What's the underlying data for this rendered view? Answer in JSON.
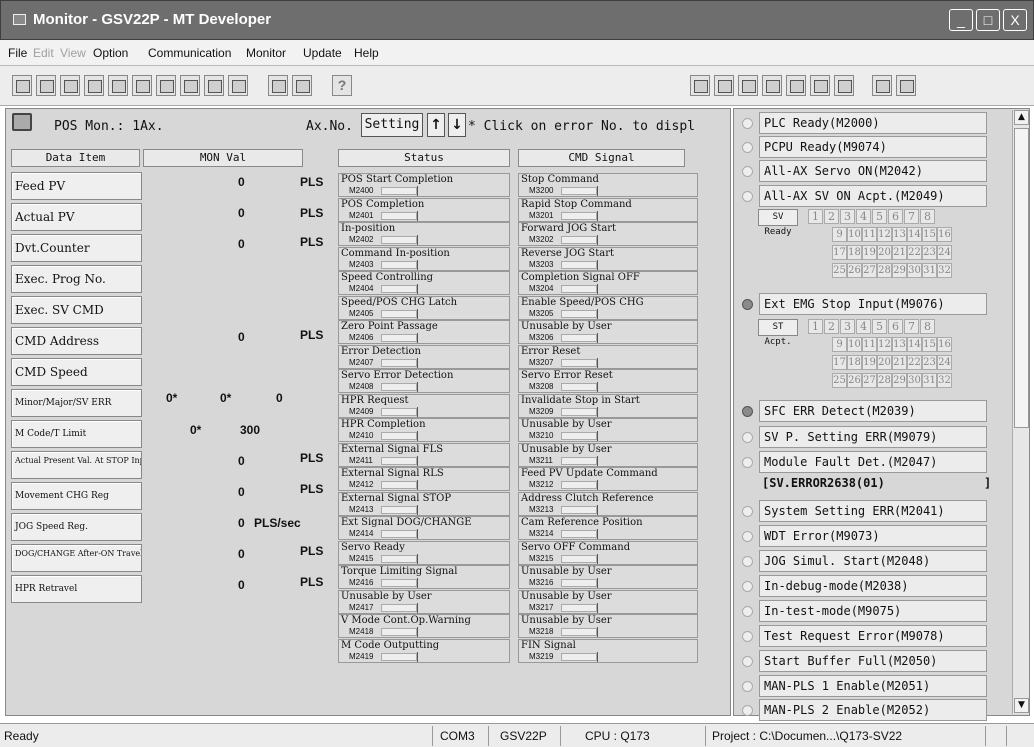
{
  "window": {
    "title": "Monitor - GSV22P - MT Developer",
    "min": "_",
    "max": "□",
    "close": "X"
  },
  "menu": [
    "File",
    "Edit",
    "View",
    "Option",
    "Communication",
    "Monitor",
    "Update",
    "Help"
  ],
  "toolbar": {
    "help": "?"
  },
  "pos": {
    "label": "POS Mon.: 1Ax.",
    "axno": "Ax.No.",
    "setting": "Setting",
    "up": "↑",
    "down": "↓",
    "note": "* Click on error No. to displ"
  },
  "headers": {
    "item": "Data Item",
    "mon": "MON Val",
    "status": "Status",
    "cmd": "CMD Signal"
  },
  "items": [
    {
      "label": "Feed PV",
      "val": "0",
      "unit": "PLS"
    },
    {
      "label": "Actual PV",
      "val": "0",
      "unit": "PLS"
    },
    {
      "label": "Dvt.Counter",
      "val": "0",
      "unit": "PLS"
    },
    {
      "label": "Exec. Prog No.",
      "val": "",
      "unit": ""
    },
    {
      "label": "Exec. SV CMD",
      "val": "",
      "unit": ""
    },
    {
      "label": "CMD Address",
      "val": "0",
      "unit": "PLS"
    },
    {
      "label": "CMD Speed",
      "val": "",
      "unit": ""
    },
    {
      "label": "Minor/Major/SV ERR",
      "v1": "0*",
      "v2": "0*",
      "v3": "0"
    },
    {
      "label": "M Code/T Limit",
      "v1": "0*",
      "v2": "300"
    },
    {
      "label": "Actual Present Val. At STOP Input",
      "val": "0",
      "unit": "PLS"
    },
    {
      "label": "Movement CHG Reg",
      "val": "0",
      "unit": "PLS"
    },
    {
      "label": "JOG Speed Reg.",
      "val": "0",
      "unit": "PLS/sec"
    },
    {
      "label": "DOG/CHANGE After-ON Travel",
      "val": "0",
      "unit": "PLS"
    },
    {
      "label": "HPR Retravel",
      "val": "0",
      "unit": "PLS"
    }
  ],
  "status": [
    {
      "name": "POS Start Completion",
      "m": "M2400"
    },
    {
      "name": "POS Completion",
      "m": "M2401"
    },
    {
      "name": "In-position",
      "m": "M2402"
    },
    {
      "name": "Command In-position",
      "m": "M2403"
    },
    {
      "name": "Speed Controlling",
      "m": "M2404"
    },
    {
      "name": "Speed/POS CHG Latch",
      "m": "M2405"
    },
    {
      "name": "Zero Point Passage",
      "m": "M2406"
    },
    {
      "name": "Error Detection",
      "m": "M2407"
    },
    {
      "name": "Servo Error Detection",
      "m": "M2408"
    },
    {
      "name": "HPR Request",
      "m": "M2409"
    },
    {
      "name": "HPR Completion",
      "m": "M2410"
    },
    {
      "name": "External Signal FLS",
      "m": "M2411"
    },
    {
      "name": "External Signal RLS",
      "m": "M2412"
    },
    {
      "name": "External Signal STOP",
      "m": "M2413"
    },
    {
      "name": "Ext Signal DOG/CHANGE",
      "m": "M2414"
    },
    {
      "name": "Servo Ready",
      "m": "M2415"
    },
    {
      "name": "Torque Limiting Signal",
      "m": "M2416"
    },
    {
      "name": "Unusable by User",
      "m": "M2417"
    },
    {
      "name": "V Mode Cont.Op.Warning",
      "m": "M2418"
    },
    {
      "name": "M Code Outputting",
      "m": "M2419"
    }
  ],
  "cmd": [
    {
      "name": "Stop Command",
      "m": "M3200"
    },
    {
      "name": "Rapid Stop Command",
      "m": "M3201"
    },
    {
      "name": "Forward JOG Start",
      "m": "M3202"
    },
    {
      "name": "Reverse JOG Start",
      "m": "M3203"
    },
    {
      "name": "Completion Signal OFF",
      "m": "M3204"
    },
    {
      "name": "Enable Speed/POS CHG",
      "m": "M3205"
    },
    {
      "name": "Unusable by User",
      "m": "M3206"
    },
    {
      "name": "Error Reset",
      "m": "M3207"
    },
    {
      "name": "Servo Error Reset",
      "m": "M3208"
    },
    {
      "name": "Invalidate Stop in Start",
      "m": "M3209"
    },
    {
      "name": "Unusable by User",
      "m": "M3210"
    },
    {
      "name": "Unusable by User",
      "m": "M3211"
    },
    {
      "name": "Feed PV Update Command",
      "m": "M3212"
    },
    {
      "name": "Address Clutch Reference",
      "m": "M3213"
    },
    {
      "name": "Cam Reference Position",
      "m": "M3214"
    },
    {
      "name": "Servo OFF Command",
      "m": "M3215"
    },
    {
      "name": "Unusable by User",
      "m": "M3216"
    },
    {
      "name": "Unusable by User",
      "m": "M3217"
    },
    {
      "name": "Unusable by User",
      "m": "M3218"
    },
    {
      "name": "FIN Signal",
      "m": "M3219"
    }
  ],
  "right": {
    "plc": "PLC Ready(M2000)",
    "pcpu": "PCPU Ready(M9074)",
    "allservo": "All-AX Servo ON(M2042)",
    "allsvacpt": "All-AX SV ON Acpt.(M2049)",
    "svready": "SV Ready",
    "extemg": "Ext EMG Stop Input(M9076)",
    "stacpt": "ST Acpt.",
    "nums": [
      "1",
      "2",
      "3",
      "4",
      "5",
      "6",
      "7",
      "8",
      "9",
      "10",
      "11",
      "12",
      "13",
      "14",
      "15",
      "16",
      "17",
      "18",
      "19",
      "20",
      "21",
      "22",
      "23",
      "24",
      "25",
      "26",
      "27",
      "28",
      "29",
      "30",
      "31",
      "32"
    ],
    "sfc": "SFC ERR Detect(M2039)",
    "svp": "SV P. Setting ERR(M9079)",
    "modfault": "Module Fault Det.(M2047)",
    "sverror": "[SV.ERROR2638(01)",
    "sverror_end": "]",
    "syserr": "System Setting ERR(M2041)",
    "wdt": "WDT Error(M9073)",
    "jog": "JOG Simul. Start(M2048)",
    "debug": "In-debug-mode(M2038)",
    "test": "In-test-mode(M9075)",
    "testreq": "Test Request Error(M9078)",
    "startbuf": "Start Buffer Full(M2050)",
    "man1": "MAN-PLS 1 Enable(M2051)",
    "man2": "MAN-PLS 2 Enable(M2052)"
  },
  "statusbar": {
    "ready": "Ready",
    "com": "COM3",
    "model": "GSV22P",
    "cpu": "CPU : Q173",
    "project": "Project : C:\\Documen...\\Q173-SV22"
  }
}
